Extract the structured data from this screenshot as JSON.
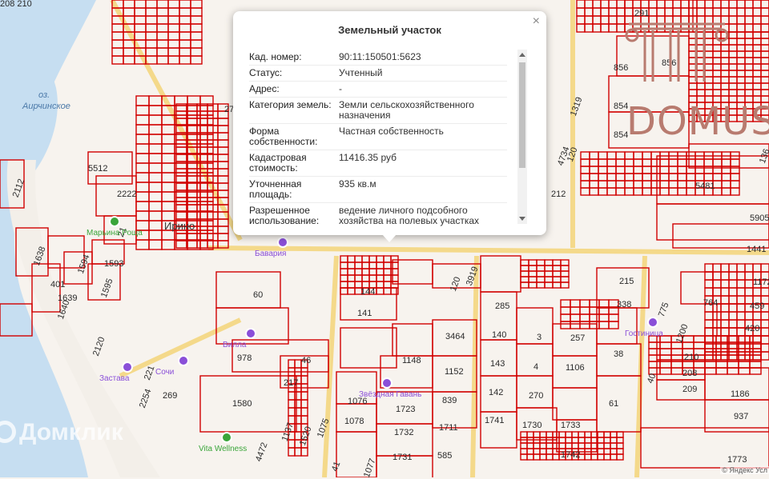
{
  "map": {
    "lake_label": "оз.\nАирчинское",
    "parcel_labels": [
      {
        "text": "291"
      },
      {
        "text": "856"
      },
      {
        "text": "856"
      },
      {
        "text": "854"
      },
      {
        "text": "854"
      },
      {
        "text": "136"
      },
      {
        "text": "5481"
      },
      {
        "text": "5905"
      },
      {
        "text": "1441"
      },
      {
        "text": "1172"
      },
      {
        "text": "459"
      },
      {
        "text": "420"
      },
      {
        "text": "764"
      },
      {
        "text": "775"
      },
      {
        "text": "1200"
      },
      {
        "text": "215"
      },
      {
        "text": "338"
      },
      {
        "text": "257"
      },
      {
        "text": "38"
      },
      {
        "text": "1106"
      },
      {
        "text": "61"
      },
      {
        "text": "210"
      },
      {
        "text": "208"
      },
      {
        "text": "209"
      },
      {
        "text": "1186"
      },
      {
        "text": "937"
      },
      {
        "text": "1773"
      },
      {
        "text": "285"
      },
      {
        "text": "140"
      },
      {
        "text": "3"
      },
      {
        "text": "143"
      },
      {
        "text": "4"
      },
      {
        "text": "142"
      },
      {
        "text": "270"
      },
      {
        "text": "1741"
      },
      {
        "text": "1730"
      },
      {
        "text": "1733"
      },
      {
        "text": "1742"
      },
      {
        "text": "3464"
      },
      {
        "text": "1148"
      },
      {
        "text": "1152"
      },
      {
        "text": "839"
      },
      {
        "text": "1723"
      },
      {
        "text": "1711"
      },
      {
        "text": "1732"
      },
      {
        "text": "585"
      },
      {
        "text": "1731"
      },
      {
        "text": "1076"
      },
      {
        "text": "1078"
      },
      {
        "text": "144"
      },
      {
        "text": "141"
      },
      {
        "text": "60"
      },
      {
        "text": "978"
      },
      {
        "text": "46"
      },
      {
        "text": "217"
      },
      {
        "text": "1580"
      },
      {
        "text": "1137"
      },
      {
        "text": "1520"
      },
      {
        "text": "1075"
      },
      {
        "text": "41"
      },
      {
        "text": "1077"
      },
      {
        "text": "4472"
      },
      {
        "text": "2254"
      },
      {
        "text": "269"
      },
      {
        "text": "221"
      },
      {
        "text": "2120"
      },
      {
        "text": "1595"
      },
      {
        "text": "1593"
      },
      {
        "text": "1594"
      },
      {
        "text": "1639"
      },
      {
        "text": "1640"
      },
      {
        "text": "401"
      },
      {
        "text": "1638"
      },
      {
        "text": "2222"
      },
      {
        "text": "5512"
      },
      {
        "text": "2112"
      },
      {
        "text": "21"
      },
      {
        "text": "212"
      },
      {
        "text": "4734"
      },
      {
        "text": "1319"
      },
      {
        "text": "120"
      },
      {
        "text": "120"
      },
      {
        "text": "3919"
      },
      {
        "text": "2735"
      },
      {
        "text": "40"
      },
      {
        "text": "208 210"
      }
    ],
    "poi": [
      {
        "name": "Марьина Роща",
        "color": "#3aa53a"
      },
      {
        "name": "Застава",
        "color": "#8a4fd8"
      },
      {
        "name": "Звёздная Гавань",
        "color": "#8a4fd8"
      },
      {
        "name": "Vita Wellness",
        "color": "#3aa53a"
      },
      {
        "name": "Гостиница",
        "color": "#8a4fd8"
      },
      {
        "name": "Вилла",
        "color": "#8a4fd8"
      },
      {
        "name": "Сочи",
        "color": "#8a4fd8"
      },
      {
        "name": "Бавария",
        "color": "#8a4fd8"
      }
    ],
    "settlement": "Ирино",
    "colors": {
      "water": "#c6def1",
      "land": "#f7f3ee",
      "parcel_line": "#d10000",
      "road": "#f4d98a",
      "poi_purple": "#8a4fd8",
      "poi_green": "#3aa53a"
    }
  },
  "popup": {
    "title": "Земельный участок",
    "close_label": "×",
    "rows": [
      {
        "key": "Кад. номер:",
        "value": "90:11:150501:5623"
      },
      {
        "key": "Статус:",
        "value": "Учтенный"
      },
      {
        "key": "Адрес:",
        "value": "-"
      },
      {
        "key": "Категория земель:",
        "value": "Земли сельскохозяйственного назначения"
      },
      {
        "key": "Форма собственности:",
        "value": "Частная собственность"
      },
      {
        "key": "Кадастровая стоимость:",
        "value": "11416.35 руб"
      },
      {
        "key": "Уточненная площадь:",
        "value": "935 кв.м"
      },
      {
        "key": "Разрешенное использование:",
        "value": "ведение личного подсобного хозяйства на полевых участках"
      }
    ]
  },
  "watermark": "Домклик",
  "logo_text": "DOMUS",
  "attribution": "© Яндекс Усл"
}
